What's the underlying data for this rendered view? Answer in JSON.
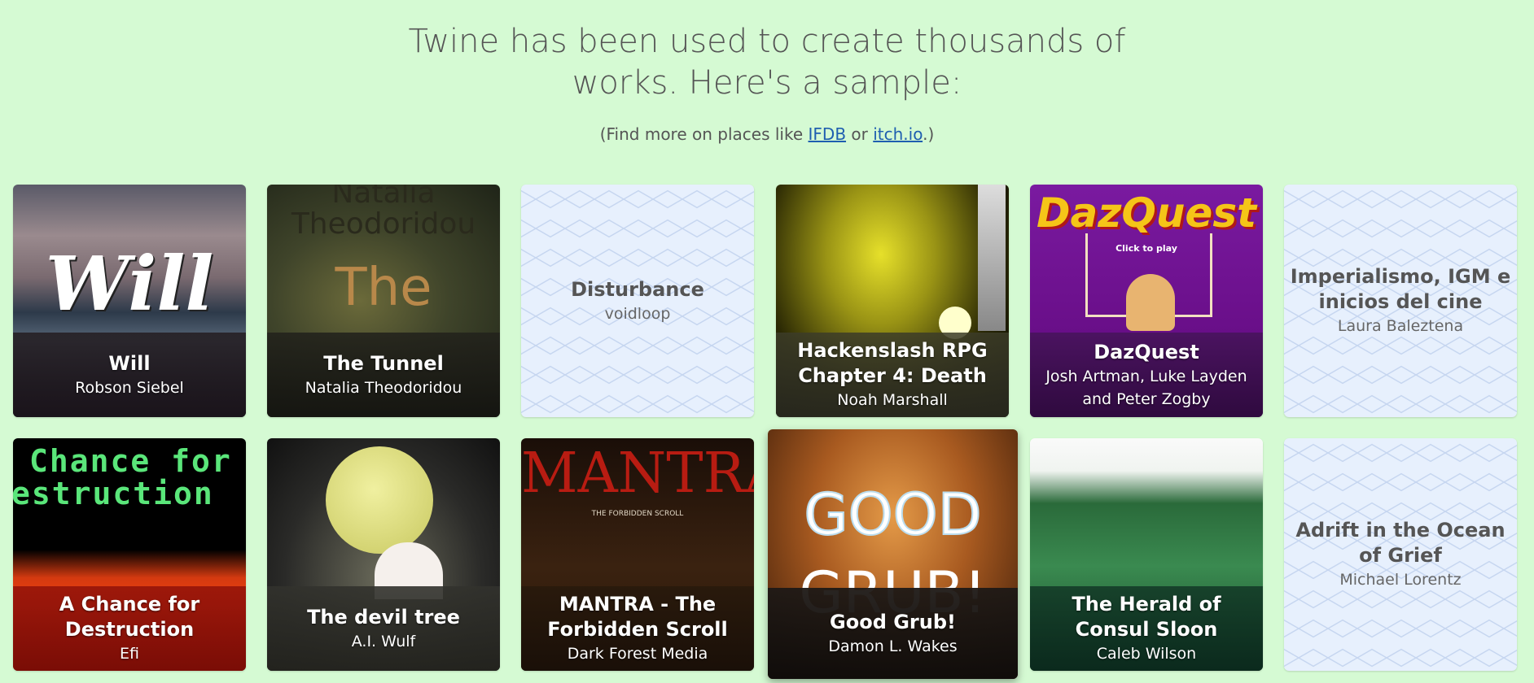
{
  "header": {
    "headline_line1": "Twine has been used to create thousands of",
    "headline_line2": "works. Here's a sample:",
    "sub_before": "(Find more on places like ",
    "link_ifdb": "IFDB",
    "sub_or": " or ",
    "link_itch": "itch.io",
    "sub_after": ".)"
  },
  "works": [
    {
      "title": "Will",
      "author": "Robson Siebel",
      "art_text": "Will"
    },
    {
      "title": "The Tunnel",
      "author": "Natalia Theodoridou",
      "art_text_1": "Natalia",
      "art_text_2": "Theodoridou",
      "art_text_3": "The"
    },
    {
      "title": "Disturbance",
      "author": "voidloop"
    },
    {
      "title": "Hackenslash RPG Chapter 4: Death",
      "author": "Noah Marshall"
    },
    {
      "title": "DazQuest",
      "author": "Josh Artman, Luke Layden and Peter Zogby",
      "art_text": "DazQuest",
      "art_sub": "Click to play"
    },
    {
      "title": "Imperialismo, IGM e inicios del cine",
      "author": "Laura Baleztena"
    },
    {
      "title": "A Chance for Destruction",
      "author": "Efi",
      "art_text_1": "Chance for",
      "art_text_2": "estruction"
    },
    {
      "title": "The devil tree",
      "author": "A.I. Wulf"
    },
    {
      "title": "MANTRA - The Forbidden Scroll",
      "author": "Dark Forest Media",
      "art_text": "MANTRA",
      "art_sub": "THE FORBIDDEN SCROLL"
    },
    {
      "title": "Good Grub!",
      "author": "Damon L. Wakes",
      "art_text": "GOOD",
      "art_text_2": "GRUB!"
    },
    {
      "title": "The Herald of Consul Sloon",
      "author": "Caleb Wilson"
    },
    {
      "title": "Adrift in the Ocean of Grief",
      "author": "Michael Lorentz"
    }
  ],
  "colors": {
    "page_background": "#d5fad3",
    "link": "#1f5fb0",
    "placeholder_card": "#e7f0fd"
  }
}
